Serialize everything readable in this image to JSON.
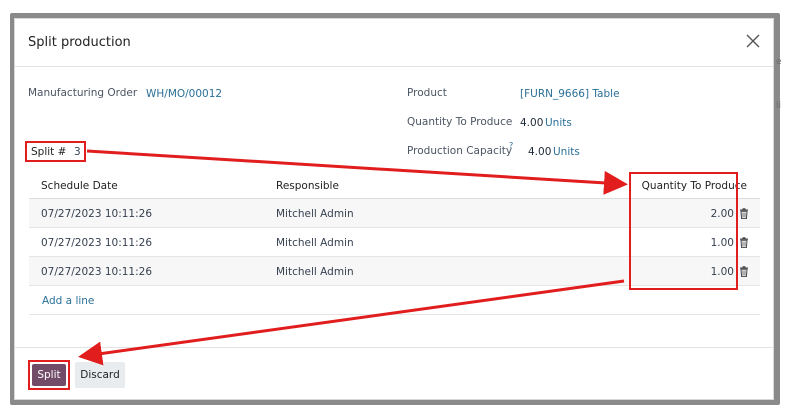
{
  "background_hints": {
    "right_top": "e",
    "right_mid": "li"
  },
  "dialog": {
    "title": "Split production",
    "close_icon": "close-icon"
  },
  "fields": {
    "manufacturing_order_label": "Manufacturing Order",
    "manufacturing_order_value": "WH/MO/00012",
    "product_label": "Product",
    "product_value": "[FURN_9666] Table",
    "qty_to_produce_label": "Quantity To Produce",
    "qty_to_produce_value": "4.00",
    "qty_to_produce_unit": "Units",
    "production_capacity_label": "Production Capacity",
    "production_capacity_tooltip": "?",
    "production_capacity_value": "4.00",
    "production_capacity_unit": "Units",
    "split_label": "Split #",
    "split_value": "3"
  },
  "table": {
    "headers": {
      "schedule_date": "Schedule Date",
      "responsible": "Responsible",
      "quantity": "Quantity To Produce"
    },
    "rows": [
      {
        "date": "07/27/2023 10:11:26",
        "responsible": "Mitchell Admin",
        "qty": "2.00"
      },
      {
        "date": "07/27/2023 10:11:26",
        "responsible": "Mitchell Admin",
        "qty": "1.00"
      },
      {
        "date": "07/27/2023 10:11:26",
        "responsible": "Mitchell Admin",
        "qty": "1.00"
      }
    ],
    "add_line": "Add a line",
    "row_delete_icon": "trash-icon"
  },
  "footer": {
    "split_button": "Split",
    "discard_button": "Discard"
  },
  "colors": {
    "primary": "#714B67",
    "link": "#2a6f97",
    "annotation": "#e11d1d"
  }
}
